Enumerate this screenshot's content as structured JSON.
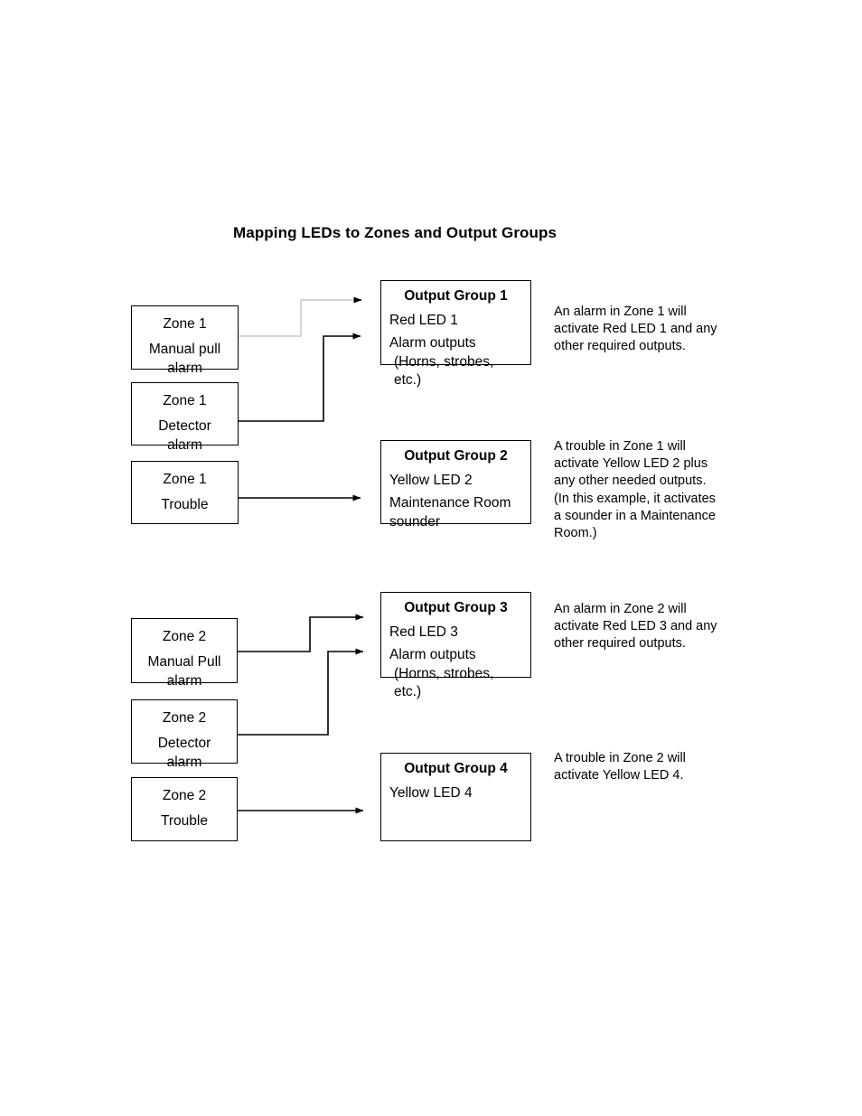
{
  "title": "Mapping LEDs to Zones and Output Groups",
  "colors": {
    "stroke": "#000000",
    "faded_stroke": "#c9c9c9",
    "background": "#ffffff"
  },
  "zones": [
    {
      "id": "zone1-manual-pull",
      "line1": "Zone 1",
      "line2": "Manual pull",
      "line3": "alarm"
    },
    {
      "id": "zone1-detector",
      "line1": "Zone 1",
      "line2": "Detector",
      "line3": "alarm"
    },
    {
      "id": "zone1-trouble",
      "line1": "Zone 1",
      "line2": "Trouble",
      "line3": ""
    },
    {
      "id": "zone2-manual-pull",
      "line1": "Zone 2",
      "line2": "Manual Pull",
      "line3": "alarm"
    },
    {
      "id": "zone2-detector",
      "line1": "Zone 2",
      "line2": "Detector",
      "line3": "alarm"
    },
    {
      "id": "zone2-trouble",
      "line1": "Zone 2",
      "line2": "Trouble",
      "line3": ""
    }
  ],
  "output_groups": [
    {
      "id": "output-group-1",
      "title": "Output Group 1",
      "line1": "Red LED 1",
      "line2": "Alarm outputs",
      "line3": "(Horns, strobes, etc.)"
    },
    {
      "id": "output-group-2",
      "title": "Output Group 2",
      "line1": "Yellow LED 2",
      "line2": "Maintenance Room",
      "line3": "sounder"
    },
    {
      "id": "output-group-3",
      "title": "Output Group 3",
      "line1": "Red LED 3",
      "line2": "Alarm outputs",
      "line3": "(Horns, strobes, etc.)"
    },
    {
      "id": "output-group-4",
      "title": "Output Group 4",
      "line1": "Yellow LED 4",
      "line2": "",
      "line3": ""
    }
  ],
  "notes": [
    {
      "id": "note-zone1-alarm",
      "text": "An alarm in Zone 1 will\nactivate Red LED 1 and any\nother required outputs."
    },
    {
      "id": "note-zone1-trouble",
      "text": "A trouble in Zone 1 will\nactivate Yellow LED 2 plus\nany other needed outputs.\n(In this example, it activates\na sounder in a Maintenance\nRoom.)"
    },
    {
      "id": "note-zone2-alarm",
      "text": "An alarm in Zone 2 will\nactivate Red LED 3 and any\nother required outputs."
    },
    {
      "id": "note-zone2-trouble",
      "text": "A trouble in Zone 2 will\nactivate Yellow LED 4."
    }
  ]
}
